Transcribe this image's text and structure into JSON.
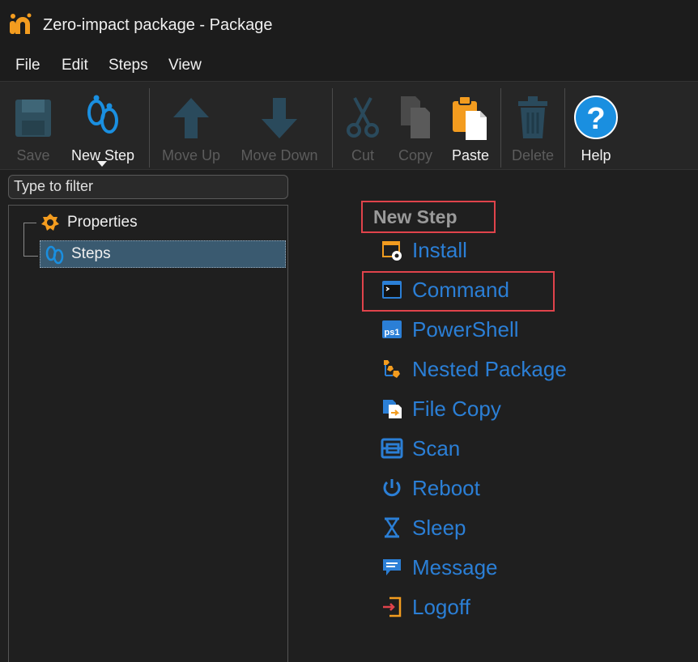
{
  "window": {
    "title": "Zero-impact package - Package",
    "logo_icon": "app-logo-icon"
  },
  "menu": [
    "File",
    "Edit",
    "Steps",
    "View"
  ],
  "toolbar": {
    "save": "Save",
    "new_step": "New Step",
    "move_up": "Move Up",
    "move_down": "Move Down",
    "cut": "Cut",
    "copy": "Copy",
    "paste": "Paste",
    "delete": "Delete",
    "help": "Help"
  },
  "filter": {
    "placeholder": "Type to filter"
  },
  "tree": {
    "items": [
      {
        "label": "Properties",
        "icon": "properties-icon"
      },
      {
        "label": "Steps",
        "icon": "steps-icon"
      }
    ]
  },
  "main": {
    "heading": "New Step",
    "steps": [
      {
        "label": "Install",
        "icon": "install-icon"
      },
      {
        "label": "Command",
        "icon": "command-icon"
      },
      {
        "label": "PowerShell",
        "icon": "powershell-icon"
      },
      {
        "label": "Nested Package",
        "icon": "nested-package-icon"
      },
      {
        "label": "File Copy",
        "icon": "file-copy-icon"
      },
      {
        "label": "Scan",
        "icon": "scan-icon"
      },
      {
        "label": "Reboot",
        "icon": "reboot-icon"
      },
      {
        "label": "Sleep",
        "icon": "sleep-icon"
      },
      {
        "label": "Message",
        "icon": "message-icon"
      },
      {
        "label": "Logoff",
        "icon": "logoff-icon"
      }
    ]
  },
  "colors": {
    "accent_orange": "#f39c1f",
    "link_blue": "#2b7fd6",
    "highlight_red": "#e0434b",
    "selection": "#3a5a70"
  }
}
